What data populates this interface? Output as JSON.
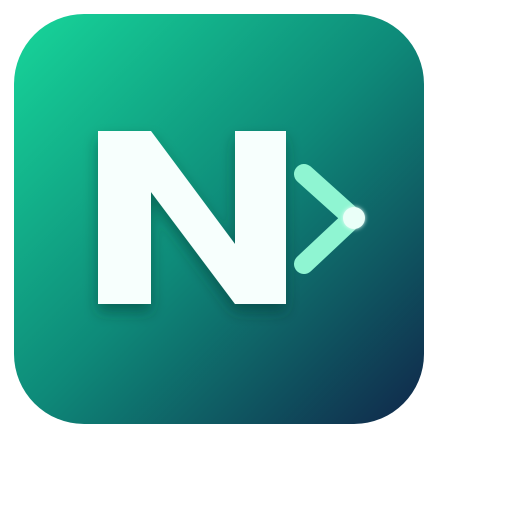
{
  "app_icon": {
    "name": "app-icon",
    "letter": "N",
    "colors": {
      "gradient_start": "#17d69a",
      "gradient_mid": "#0e8a79",
      "gradient_end": "#10264a",
      "letter_fill": "#f7fffd",
      "chevron_stroke": "#8ff5d2",
      "chevron_dot": "#eafff8"
    }
  }
}
